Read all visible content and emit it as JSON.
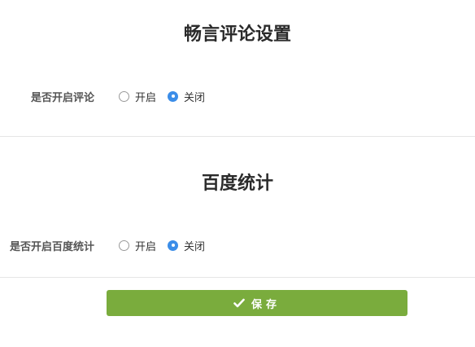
{
  "comments": {
    "title": "畅言评论设置",
    "field_label": "是否开启评论",
    "options": [
      {
        "label": "开启",
        "checked": false
      },
      {
        "label": "关闭",
        "checked": true
      }
    ]
  },
  "stats": {
    "title": "百度统计",
    "field_label": "是否开启百度统计",
    "options": [
      {
        "label": "开启",
        "checked": false
      },
      {
        "label": "关闭",
        "checked": true
      }
    ]
  },
  "save_button": {
    "label": "保存",
    "icon": "check-icon",
    "color": "#7aac3d"
  },
  "accent_color": "#3b8de8"
}
